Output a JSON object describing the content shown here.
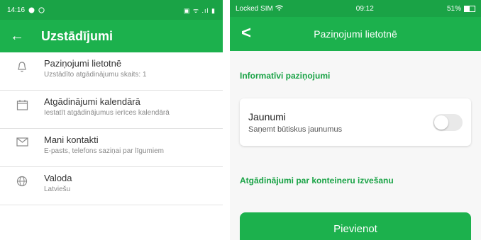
{
  "left": {
    "status": {
      "time": "14:16",
      "icons_right": "▣ ᯤ .ıl ▮"
    },
    "appbar": {
      "back_icon": "arrow-left-icon",
      "title": "Uzstādījumi"
    },
    "rows": [
      {
        "icon": "bell-icon",
        "title": "Paziņojumi lietotnē",
        "subtitle": "Uzstādīto atgādinājumu skaits: 1"
      },
      {
        "icon": "calendar-icon",
        "title": "Atgādinājumi kalendārā",
        "subtitle": "Iestatīt atgādinājumus ierīces kalendārā"
      },
      {
        "icon": "envelope-icon",
        "title": "Mani kontakti",
        "subtitle": "E-pasts, telefons saziņai par līgumiem"
      },
      {
        "icon": "globe-icon",
        "title": "Valoda",
        "subtitle": "Latviešu"
      }
    ]
  },
  "right": {
    "status": {
      "carrier": "Locked SIM",
      "time": "09:12",
      "battery": "51%"
    },
    "nav": {
      "back_icon": "chevron-left-icon",
      "title": "Paziņojumi lietotnē"
    },
    "section1": "Informatīvi paziņojumi",
    "card": {
      "title": "Jaunumi",
      "subtitle": "Saņemt būtiskus jaunumus",
      "toggle_on": false
    },
    "section2": "Atgādinājumi par konteineru izvešanu",
    "button": "Pievienot"
  },
  "colors": {
    "brand_green": "#1cb14d",
    "status_green": "#1aa346"
  }
}
